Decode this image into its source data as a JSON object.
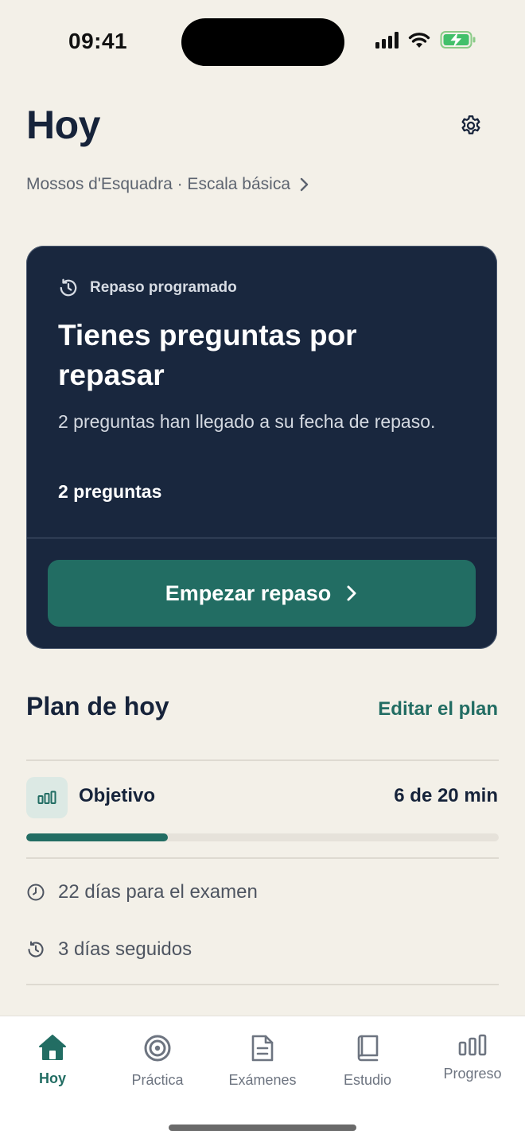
{
  "status_bar": {
    "time": "09:41"
  },
  "header": {
    "title": "Hoy",
    "breadcrumb": "Mossos d'Esquadra · Escala básica"
  },
  "review_card": {
    "tag": "Repaso programado",
    "title": "Tienes preguntas por repasar",
    "description": "2 preguntas han llegado a su fecha de repaso.",
    "count": "2 preguntas",
    "button_label": "Empezar repaso"
  },
  "plan": {
    "title": "Plan de hoy",
    "edit_label": "Editar el plan",
    "goal_label": "Objetivo",
    "goal_value": "6 de 20 min",
    "goal_progress": 0.3,
    "exam_countdown": "22 días para el examen",
    "streak": "3 días seguidos"
  },
  "colors": {
    "accent": "#226d63",
    "card_bg": "#19273e",
    "page_bg": "#f3f0e8"
  },
  "tabs": [
    {
      "label": "Hoy",
      "icon": "home-icon",
      "active": true
    },
    {
      "label": "Práctica",
      "icon": "target-icon",
      "active": false
    },
    {
      "label": "Exámenes",
      "icon": "document-icon",
      "active": false
    },
    {
      "label": "Estudio",
      "icon": "book-icon",
      "active": false
    },
    {
      "label": "Progreso",
      "icon": "bar-chart-icon",
      "active": false
    }
  ]
}
